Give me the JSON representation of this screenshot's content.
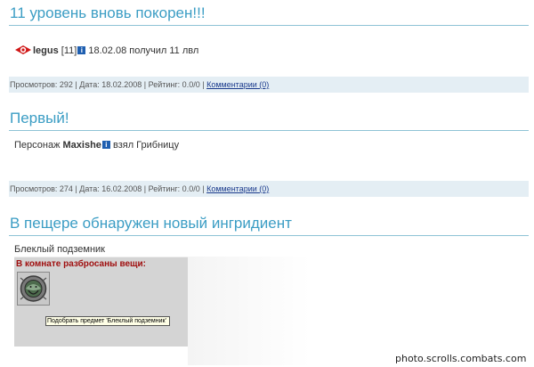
{
  "posts": [
    {
      "title": "11 уровень вновь покорен!!!",
      "author": "legus",
      "author_level": "[11]",
      "body_text": "18.02.08 получил 11 лвл",
      "views": "Просмотров: 292",
      "date": "Дата: 18.02.2008",
      "rating": "Рейтинг: 0.0/0",
      "comments_link": "Комментарии (0)"
    },
    {
      "title": "Первый!",
      "body_prefix": "Персонаж",
      "character": "Maxishe",
      "body_suffix": "взял Грибницу",
      "views": "Просмотров: 274",
      "date": "Дата: 16.02.2008",
      "rating": "Рейтинг: 0.0/0",
      "comments_link": "Комментарии (0)"
    },
    {
      "title": "В пещере обнаружен новый ингридиент",
      "item_name": "Блеклый подземник",
      "scene_caption": "В комнате разбросаны вещи:",
      "tooltip": "Подобрать предмет 'Блеклый подземник'"
    }
  ],
  "separator": "|",
  "info_glyph": "i",
  "watermark": "photo.scrolls.combats.com",
  "colors": {
    "title": "#3b9dc4",
    "rule": "#8fc3d6",
    "meta_bg": "#e4eef4",
    "link": "#1a3a8c",
    "scene_caption": "#a01010"
  }
}
